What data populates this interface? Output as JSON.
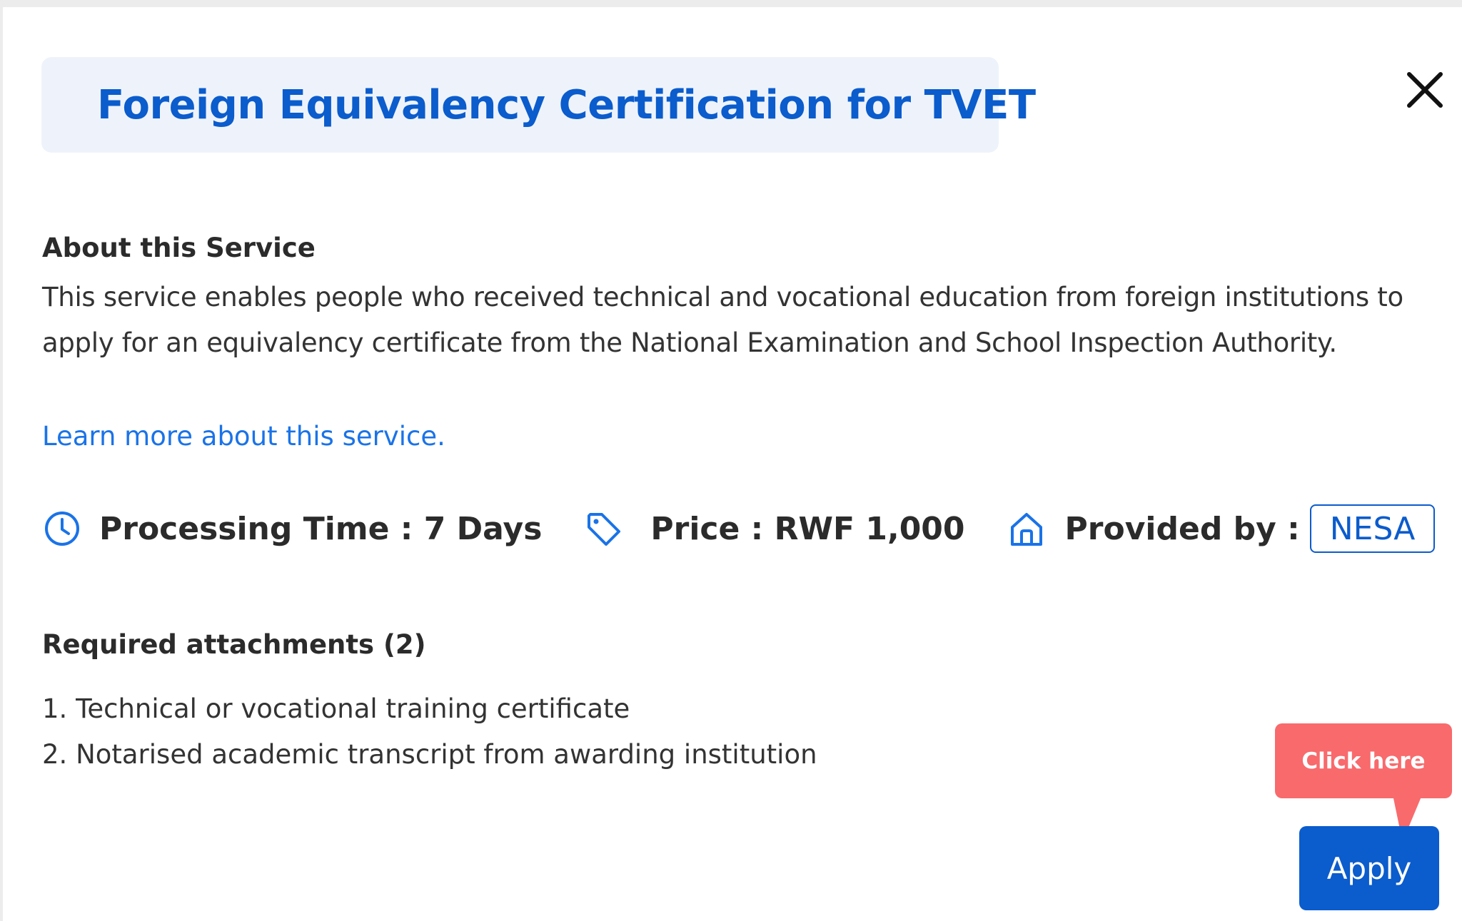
{
  "modal": {
    "title": "Foreign Equivalency Certification for TVET",
    "close_icon": "close-icon"
  },
  "about": {
    "heading": "About this Service",
    "body": "This service enables people who received technical and vocational education from foreign institutions to apply for an equivalency certificate from the National Examination and School Inspection Authority.",
    "learn_more": "Learn more about this service."
  },
  "meta": {
    "processing_icon": "clock-icon",
    "processing_text": "Processing Time : 7 Days",
    "price_icon": "tag-icon",
    "price_text": "Price : RWF 1,000",
    "provider_icon": "home-icon",
    "provider_label": "Provided by :",
    "provider_badge": "NESA"
  },
  "attachments": {
    "heading": "Required attachments (2)",
    "items": [
      "1. Technical or vocational training certificate",
      "2. Notarised academic transcript from awarding institution"
    ]
  },
  "callout": {
    "text": "Click here"
  },
  "actions": {
    "apply_label": "Apply"
  },
  "colors": {
    "accent": "#0b5ccc",
    "link": "#1a73e8",
    "title_bg": "#eef3fb",
    "callout": "#f86a6c"
  }
}
